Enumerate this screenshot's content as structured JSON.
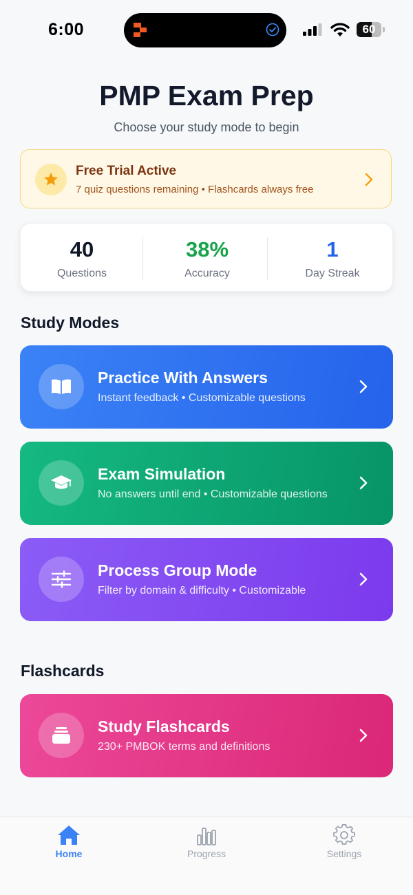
{
  "status_bar": {
    "time": "6:00",
    "battery": "60"
  },
  "header": {
    "title": "PMP Exam Prep",
    "subtitle": "Choose your study mode to begin"
  },
  "trial_banner": {
    "title": "Free Trial Active",
    "subtitle": "7 quiz questions remaining • Flashcards always free",
    "icon": "star-icon"
  },
  "stats": [
    {
      "value": "40",
      "label": "Questions",
      "color": "#111827"
    },
    {
      "value": "38%",
      "label": "Accuracy",
      "color": "#16a34a"
    },
    {
      "value": "1",
      "label": "Day Streak",
      "color": "#2563eb"
    }
  ],
  "study_modes": {
    "heading": "Study Modes",
    "items": [
      {
        "title": "Practice With Answers",
        "subtitle": "Instant feedback • Customizable questions",
        "icon": "book-open-icon"
      },
      {
        "title": "Exam Simulation",
        "subtitle": "No answers until end • Customizable questions",
        "icon": "graduation-cap-icon"
      },
      {
        "title": "Process Group Mode",
        "subtitle": "Filter by domain & difficulty • Customizable",
        "icon": "sliders-icon"
      }
    ]
  },
  "flashcards": {
    "heading": "Flashcards",
    "item": {
      "title": "Study Flashcards",
      "subtitle": "230+ PMBOK terms and definitions",
      "icon": "cards-stack-icon"
    }
  },
  "tab_bar": {
    "tabs": [
      {
        "label": "Home",
        "icon": "home-icon",
        "active": true
      },
      {
        "label": "Progress",
        "icon": "bar-chart-icon",
        "active": false
      },
      {
        "label": "Settings",
        "icon": "gear-icon",
        "active": false
      }
    ]
  },
  "colors": {
    "accent": "#3b82f6",
    "inactive_tab": "#9ca3af"
  }
}
